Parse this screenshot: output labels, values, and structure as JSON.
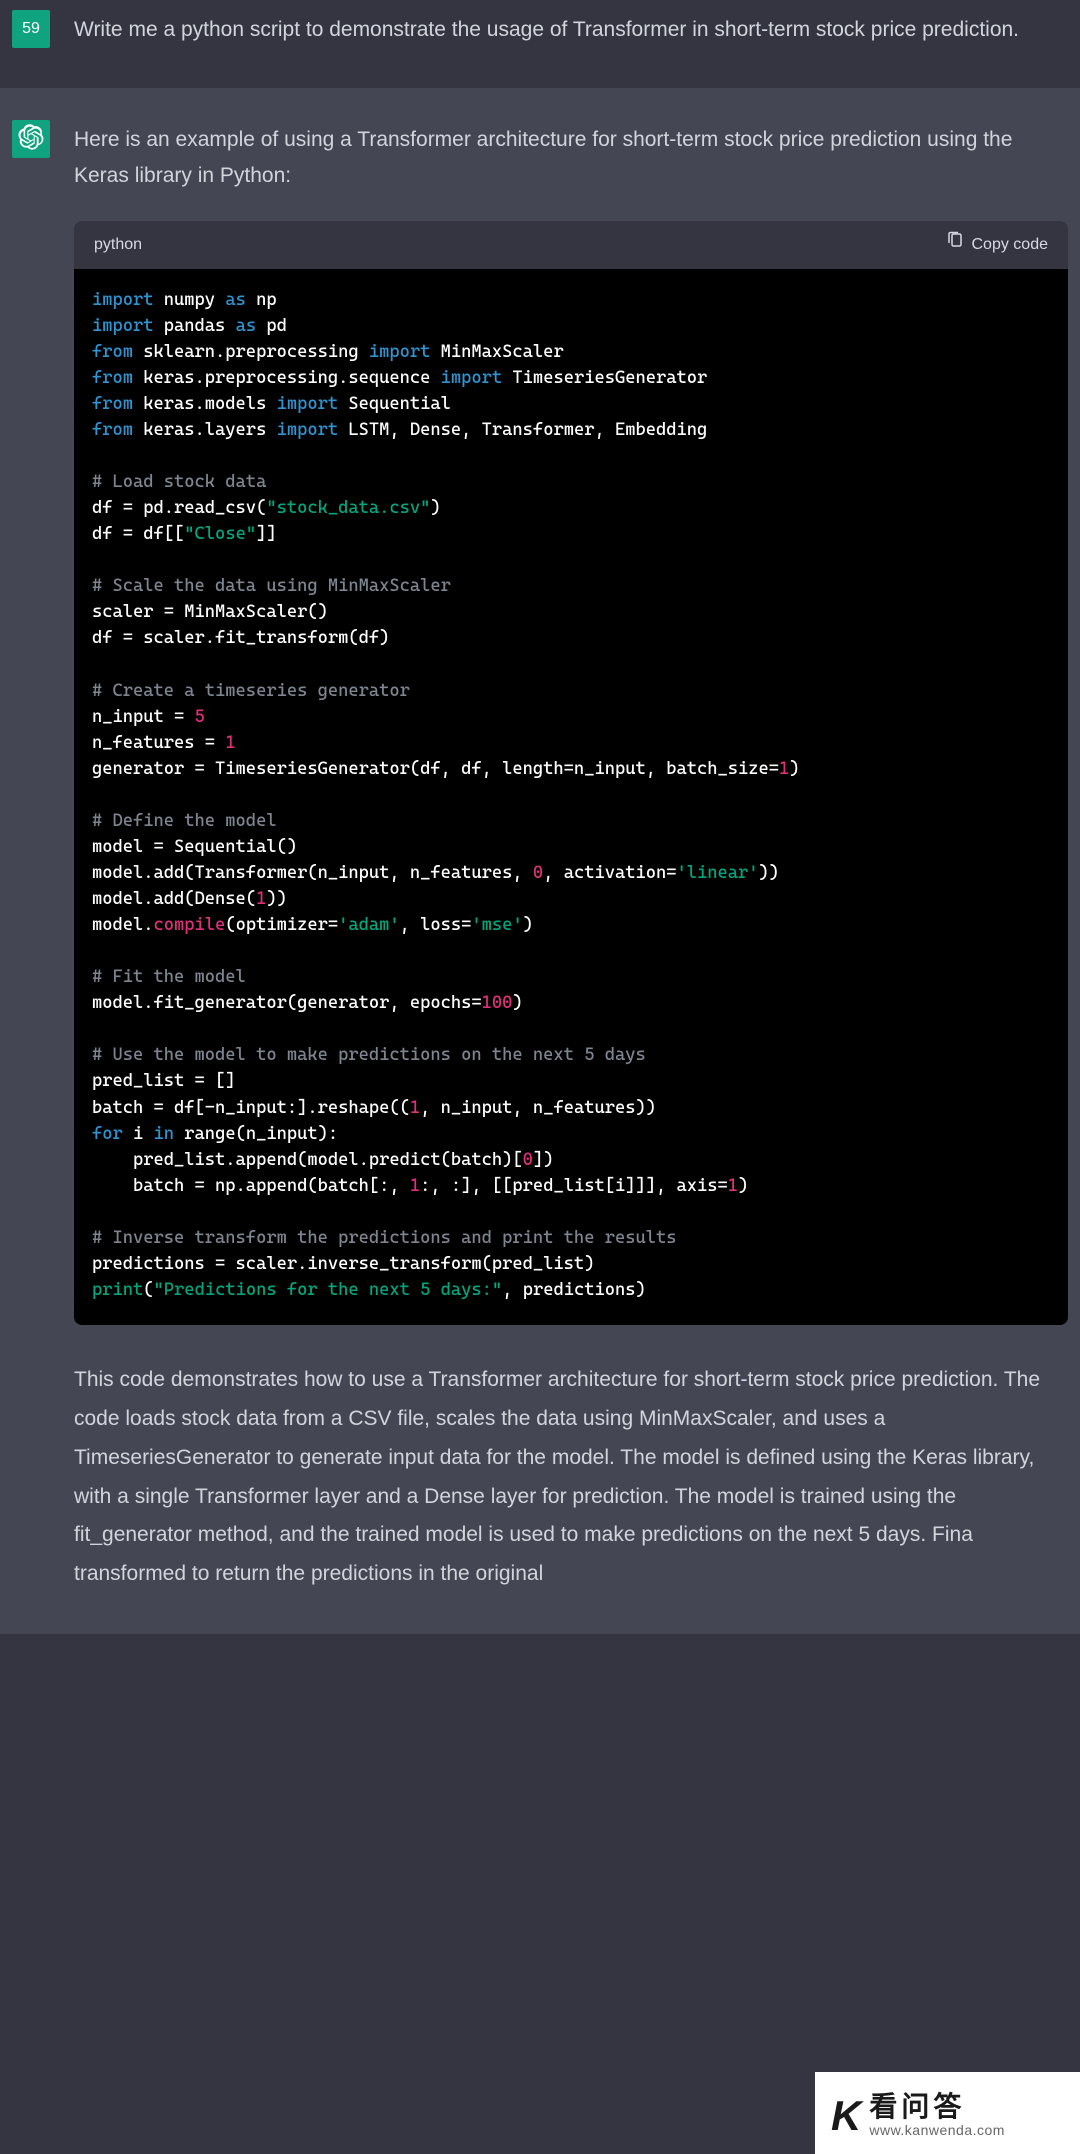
{
  "user": {
    "avatar_text": "59",
    "message": "Write me a python script to demonstrate the usage of Transformer in short-term stock price prediction."
  },
  "assistant": {
    "intro": "Here is an example of using a Transformer architecture for short-term stock price prediction using the Keras library in Python:",
    "code_lang": "python",
    "copy_label": "Copy code",
    "explanation": "This code demonstrates how to use a Transformer architecture for short-term stock price prediction. The code loads stock data from a CSV file, scales the data using MinMaxScaler, and uses a TimeseriesGenerator to generate input data for the model. The model is defined using the Keras library, with a single Transformer layer and a Dense layer for prediction. The model is trained using the fit_generator method, and the trained model is used to make predictions on the next 5 days. Fina"
  },
  "code": {
    "l01_import": "import",
    "l01_numpy": " numpy ",
    "l01_as": "as",
    "l01_np": " np",
    "l02_import": "import",
    "l02_pandas": " pandas ",
    "l02_as": "as",
    "l02_pd": " pd",
    "l03_from": "from",
    "l03_mod": " sklearn.preprocessing ",
    "l03_import": "import",
    "l03_cls": " MinMaxScaler",
    "l04_from": "from",
    "l04_mod": " keras.preprocessing.sequence ",
    "l04_import": "import",
    "l04_cls": " TimeseriesGenerator",
    "l05_from": "from",
    "l05_mod": " keras.models ",
    "l05_import": "import",
    "l05_cls": " Sequential",
    "l06_from": "from",
    "l06_mod": " keras.layers ",
    "l06_import": "import",
    "l06_cls": " LSTM, Dense, Transformer, Embedding",
    "c1": "# Load stock data",
    "l07a": "df = pd.read_csv(",
    "l07b": "\"stock_data.csv\"",
    "l07c": ")",
    "l08a": "df = df[[",
    "l08b": "\"Close\"",
    "l08c": "]]",
    "c2": "# Scale the data using MinMaxScaler",
    "l09": "scaler = MinMaxScaler()",
    "l10": "df = scaler.fit_transform(df)",
    "c3": "# Create a timeseries generator",
    "l11a": "n_input = ",
    "l11b": "5",
    "l12a": "n_features = ",
    "l12b": "1",
    "l13a": "generator = TimeseriesGenerator(df, df, length=n_input, batch_size=",
    "l13b": "1",
    "l13c": ")",
    "c4": "# Define the model",
    "l14": "model = Sequential()",
    "l15a": "model.add(Transformer(n_input, n_features, ",
    "l15b": "0",
    "l15c": ", activation=",
    "l15d": "'linear'",
    "l15e": "))",
    "l16a": "model.add(Dense(",
    "l16b": "1",
    "l16c": "))",
    "l17a": "model.",
    "l17b": "compile",
    "l17c": "(optimizer=",
    "l17d": "'adam'",
    "l17e": ", loss=",
    "l17f": "'mse'",
    "l17g": ")",
    "c5": "# Fit the model",
    "l18a": "model.fit_generator(generator, epochs=",
    "l18b": "100",
    "l18c": ")",
    "c6": "# Use the model to make predictions on the next 5 days",
    "l19": "pred_list = []",
    "l20a": "batch = df[-n_input:].reshape((",
    "l20b": "1",
    "l20c": ", n_input, n_features))",
    "l21a": "for",
    "l21b": " i ",
    "l21c": "in",
    "l21d": " range(n_input):",
    "l22a": "    pred_list.append(model.predict(batch)[",
    "l22b": "0",
    "l22c": "])",
    "l23a": "    batch = np.append(batch[:, ",
    "l23b": "1",
    "l23c": ":, :], [[pred_list[i]]], axis=",
    "l23d": "1",
    "l23e": ")",
    "c7": "# Inverse transform the predictions and print the results",
    "l24": "predictions = scaler.inverse_transform(pred_list)",
    "l25a": "print",
    "l25b": "(",
    "l25c": "\"Predictions for the next 5 days:\"",
    "l25d": ", predictions)"
  },
  "watermark": {
    "cn": "看问答",
    "url": "www.kanwenda.com"
  },
  "explanation_tail": "transformed to return the predictions in the original"
}
